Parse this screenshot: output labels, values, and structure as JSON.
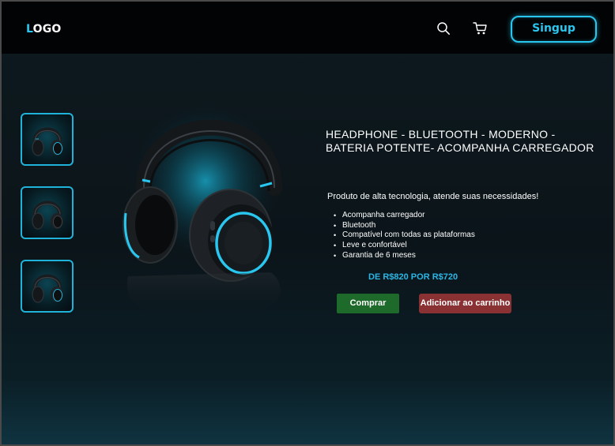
{
  "header": {
    "logo_first": "L",
    "logo_rest": "OGO",
    "search_icon": "search-icon",
    "cart_icon": "cart-icon",
    "signup_label": "Singup"
  },
  "gallery": {
    "thumbnails": [
      "headphone-thumb-1",
      "headphone-thumb-2",
      "headphone-thumb-3"
    ],
    "main_image": "headphone-image"
  },
  "product": {
    "title": "HEADPHONE - BLUETOOTH  - MODERNO - BATERIA POTENTE- ACOMPANHA CARREGADOR",
    "description": "Produto de alta tecnologia, atende suas necessidades!",
    "features": [
      "Acompanha carregador",
      "Bluetooth",
      "Compatível com todas as plataformas",
      "Leve e confortável",
      "Garantia de 6 meses"
    ],
    "price_text": "DE R$820  POR R$720",
    "buy_label": "Comprar",
    "add_to_cart_label": "Adicionar ao carrinho"
  },
  "colors": {
    "accent": "#29c7f0",
    "header_bg": "#020304",
    "buy_button": "#1d6a2a",
    "cart_button": "#8a3134",
    "price": "#29b6e6"
  }
}
